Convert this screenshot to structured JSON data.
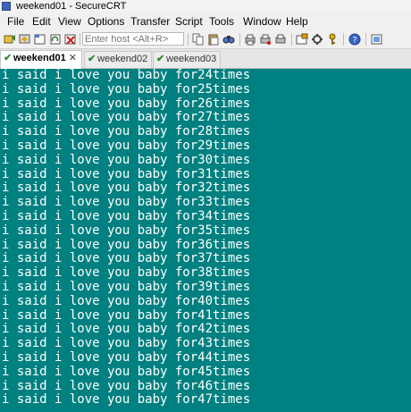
{
  "window": {
    "title": "weekend01 - SecureCRT"
  },
  "menu": [
    "File",
    "Edit",
    "View",
    "Options",
    "Transfer",
    "Script",
    "Tools",
    "Window",
    "Help"
  ],
  "toolbar": {
    "host_placeholder": "Enter host <Alt+R>",
    "icons": [
      "connect-icon",
      "quick-connect-icon",
      "connect-tab-icon",
      "reconnect-icon",
      "disconnect-icon",
      "copy-icon",
      "paste-icon",
      "find-icon",
      "print-icon",
      "print-setup-icon",
      "session-options-icon",
      "global-options-icon",
      "keymap-icon",
      "help-icon",
      "sftp-icon"
    ]
  },
  "tabs": [
    {
      "label": "weekend01",
      "active": true,
      "status": "connected"
    },
    {
      "label": "weekend02",
      "active": false,
      "status": "connected"
    },
    {
      "label": "weekend03",
      "active": false,
      "status": "connected"
    }
  ],
  "terminal": {
    "lines": [
      "i said i love you baby for24times",
      "i said i love you baby for25times",
      "i said i love you baby for26times",
      "i said i love you baby for27times",
      "i said i love you baby for28times",
      "i said i love you baby for29times",
      "i said i love you baby for30times",
      "i said i love you baby for31times",
      "i said i love you baby for32times",
      "i said i love you baby for33times",
      "i said i love you baby for34times",
      "i said i love you baby for35times",
      "i said i love you baby for36times",
      "i said i love you baby for37times",
      "i said i love you baby for38times",
      "i said i love you baby for39times",
      "i said i love you baby for40times",
      "i said i love you baby for41times",
      "i said i love you baby for42times",
      "i said i love you baby for43times",
      "i said i love you baby for44times",
      "i said i love you baby for45times",
      "i said i love you baby for46times",
      "i said i love you baby for47times"
    ],
    "background": "#008080",
    "foreground": "#ffffff"
  }
}
